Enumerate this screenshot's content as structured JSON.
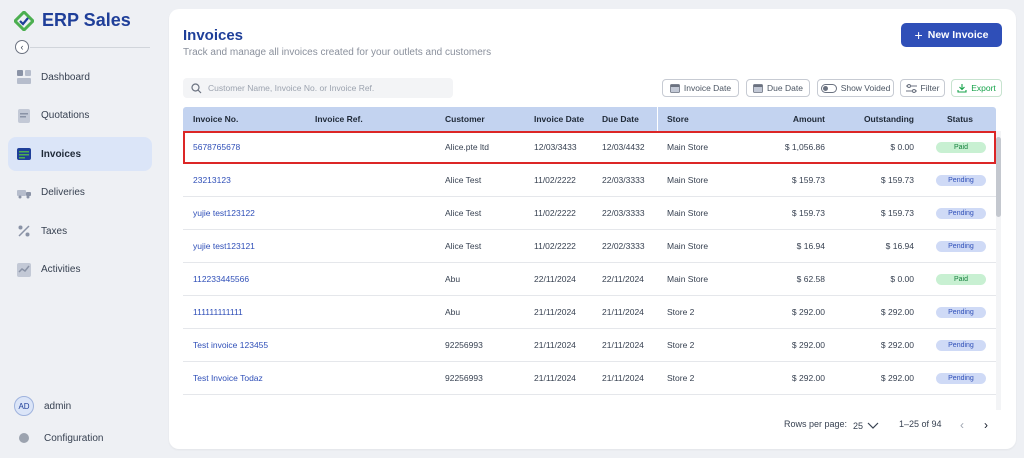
{
  "brand": {
    "name": "ERP Sales"
  },
  "sidebar": {
    "items": [
      {
        "label": "Dashboard",
        "icon": "dashboard-icon",
        "active": false
      },
      {
        "label": "Quotations",
        "icon": "quotations-icon",
        "active": false
      },
      {
        "label": "Invoices",
        "icon": "invoices-icon",
        "active": true
      },
      {
        "label": "Deliveries",
        "icon": "deliveries-icon",
        "active": false
      },
      {
        "label": "Taxes",
        "icon": "taxes-icon",
        "active": false
      },
      {
        "label": "Activities",
        "icon": "activities-icon",
        "active": false
      }
    ],
    "user": {
      "initials": "AD",
      "name": "admin"
    },
    "configuration_label": "Configuration"
  },
  "header": {
    "title": "Invoices",
    "subtitle": "Track and manage all invoices created for your outlets and customers",
    "new_button_label": "New Invoice"
  },
  "toolbar": {
    "search_placeholder": "Customer Name, Invoice No. or Invoice Ref.",
    "invoice_date_label": "Invoice Date",
    "due_date_label": "Due Date",
    "show_voided_label": "Show Voided",
    "filter_label": "Filter",
    "export_label": "Export"
  },
  "table": {
    "columns": [
      "Invoice No.",
      "Invoice Ref.",
      "Customer",
      "Invoice Date",
      "Due Date",
      "Store",
      "Amount",
      "Outstanding",
      "Status"
    ],
    "rows": [
      [
        "5678765678",
        "",
        "Alice.pte ltd",
        "12/03/3433",
        "12/03/4432",
        "Main Store",
        "$ 1,056.86",
        "$ 0.00",
        "Paid"
      ],
      [
        "23213123",
        "",
        "Alice Test",
        "11/02/2222",
        "22/03/3333",
        "Main Store",
        "$ 159.73",
        "$ 159.73",
        "Pending"
      ],
      [
        "yujie test123122",
        "",
        "Alice Test",
        "11/02/2222",
        "22/03/3333",
        "Main Store",
        "$ 159.73",
        "$ 159.73",
        "Pending"
      ],
      [
        "yujie test123121",
        "",
        "Alice Test",
        "11/02/2222",
        "22/02/3333",
        "Main Store",
        "$ 16.94",
        "$ 16.94",
        "Pending"
      ],
      [
        "112233445566",
        "",
        "Abu",
        "22/11/2024",
        "22/11/2024",
        "Main Store",
        "$ 62.58",
        "$ 0.00",
        "Paid"
      ],
      [
        "111111111111",
        "",
        "Abu",
        "21/11/2024",
        "21/11/2024",
        "Store 2",
        "$ 292.00",
        "$ 292.00",
        "Pending"
      ],
      [
        "Test invoice 123455",
        "",
        "92256993",
        "21/11/2024",
        "21/11/2024",
        "Store 2",
        "$ 292.00",
        "$ 292.00",
        "Pending"
      ],
      [
        "Test Invoice Todaz",
        "",
        "92256993",
        "21/11/2024",
        "21/11/2024",
        "Store 2",
        "$ 292.00",
        "$ 292.00",
        "Pending"
      ]
    ],
    "selected_row": 0
  },
  "pagination": {
    "rows_per_page_label": "Rows per page:",
    "rows_per_page_value": "25",
    "range_label": "1–25 of 94"
  },
  "colors": {
    "brand": "#1f3f99",
    "accent": "#2f4fb8",
    "header_row": "#c3d3f0",
    "paid": "#c8f0d2",
    "pending": "#cfdaf6",
    "selection": "#dc2626",
    "export": "#16a34a"
  }
}
